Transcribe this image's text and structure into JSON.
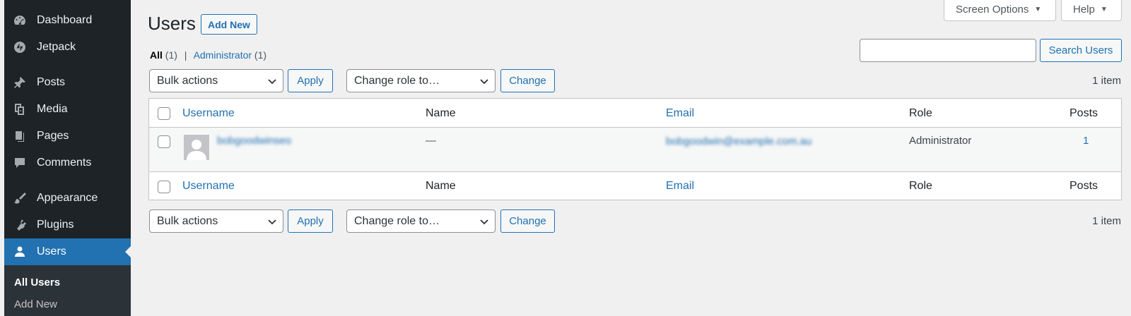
{
  "sidebar": {
    "items": [
      {
        "label": "Dashboard",
        "icon": "dashboard-icon"
      },
      {
        "label": "Jetpack",
        "icon": "jetpack-icon"
      },
      {
        "label": "Posts",
        "icon": "pin-icon"
      },
      {
        "label": "Media",
        "icon": "media-icon"
      },
      {
        "label": "Pages",
        "icon": "pages-icon"
      },
      {
        "label": "Comments",
        "icon": "comment-icon"
      },
      {
        "label": "Appearance",
        "icon": "brush-icon"
      },
      {
        "label": "Plugins",
        "icon": "plugin-icon"
      },
      {
        "label": "Users",
        "icon": "user-icon",
        "active": true
      }
    ],
    "submenu": [
      "All Users",
      "Add New"
    ]
  },
  "header": {
    "screen_options": "Screen Options",
    "help": "Help",
    "title": "Users",
    "add_new": "Add New"
  },
  "filters": {
    "all_label": "All",
    "all_count": "(1)",
    "separator": "|",
    "admin_label": "Administrator",
    "admin_count": "(1)"
  },
  "search": {
    "value": "",
    "button": "Search Users"
  },
  "actions": {
    "bulk": "Bulk actions",
    "apply": "Apply",
    "change_role": "Change role to…",
    "change": "Change",
    "count": "1 item"
  },
  "table": {
    "columns": [
      "Username",
      "Name",
      "Email",
      "Role",
      "Posts"
    ],
    "rows": [
      {
        "username": "bobgoodwinseo",
        "name": "—",
        "email": "bobgoodwin@example.com.au",
        "role": "Administrator",
        "posts": "1"
      }
    ]
  },
  "colors": {
    "sidebar_bg": "#1d2327",
    "accent": "#2271b1",
    "page_bg": "#f0f0f1"
  }
}
